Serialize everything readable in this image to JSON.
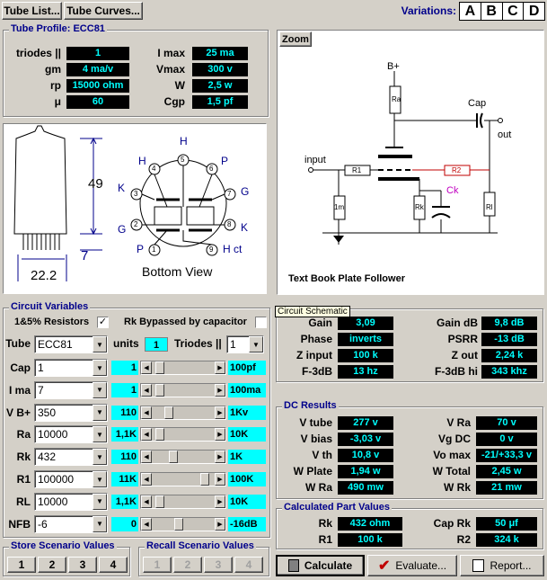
{
  "toolbar": {
    "tube_list": "Tube List...",
    "tube_curves": "Tube Curves...",
    "variations_label": "Variations:",
    "variations": [
      "A",
      "B",
      "C",
      "D"
    ]
  },
  "profile": {
    "title": "Tube Profile: ECC81",
    "left": [
      {
        "label": "triodes ||",
        "value": "1"
      },
      {
        "label": "gm",
        "value": "4 ma/v"
      },
      {
        "label": "rp",
        "value": "15000 ohm"
      },
      {
        "label": "μ",
        "value": "60"
      }
    ],
    "right": [
      {
        "label": "I max",
        "value": "25 ma"
      },
      {
        "label": "Vmax",
        "value": "300 v"
      },
      {
        "label": "W",
        "value": "2,5 w"
      },
      {
        "label": "Cgp",
        "value": "1,5 pf"
      }
    ]
  },
  "tube_drawing": {
    "dim_height": "49",
    "dim_pin": "7",
    "dim_width": "22.2",
    "caption": "Bottom View",
    "pins": [
      "1",
      "2",
      "3",
      "4",
      "5",
      "6",
      "7",
      "8",
      "9"
    ],
    "pin_labels": {
      "H_top": "H",
      "H_left": "H",
      "P_right": "P",
      "K_left": "K",
      "G_right": "G",
      "G_left": "G",
      "K_right": "K",
      "P_bottom": "P",
      "Hct": "H ct"
    }
  },
  "schematic": {
    "zoom": "Zoom",
    "bplus": "B+",
    "ra": "Ra",
    "cap": "Cap",
    "out": "out",
    "input": "input",
    "r1": "R1",
    "r2": "R2",
    "ck": "Ck",
    "one_m": "1m",
    "rk": "Rk",
    "rl": "Rl",
    "caption": "Text Book Plate Follower",
    "tooltip": "Circuit Schematic"
  },
  "circuit": {
    "title": "Circuit Variables",
    "resistors_label": "1&5% Resistors",
    "resistors_checked": "✓",
    "rk_bypass_label": "Rk Bypassed by capacitor",
    "rk_bypass_checked": "",
    "tube_label": "Tube",
    "tube_value": "ECC81",
    "units_label": "units",
    "units_value": "1",
    "triodes_label": "Triodes ||",
    "triodes_value": "1",
    "rows": [
      {
        "label": "Cap",
        "value": "1",
        "num": "1",
        "unit": "100pf",
        "level": 0.05
      },
      {
        "label": "I ma",
        "value": "7",
        "num": "1",
        "unit": "100ma",
        "level": 0.05
      },
      {
        "label": "V B+",
        "value": "350",
        "num": "110",
        "unit": "1Kv",
        "level": 0.22
      },
      {
        "label": "Ra",
        "value": "10000",
        "num": "1,1K",
        "unit": "10K",
        "level": 0.05
      },
      {
        "label": "Rk",
        "value": "432",
        "num": "110",
        "unit": "1K",
        "level": 0.3
      },
      {
        "label": "R1",
        "value": "100000",
        "num": "11K",
        "unit": "100K",
        "level": 0.9
      },
      {
        "label": "RL",
        "value": "10000",
        "num": "1,1K",
        "unit": "10K",
        "level": 0.05
      },
      {
        "label": "NFB",
        "value": "-6",
        "num": "0",
        "unit": "-16dB",
        "level": 0.4
      }
    ]
  },
  "store": {
    "title": "Store Scenario Values",
    "buttons": [
      "1",
      "2",
      "3",
      "4"
    ]
  },
  "recall": {
    "title": "Recall Scenario Values",
    "buttons": [
      "1",
      "2",
      "3",
      "4"
    ]
  },
  "perf": {
    "left": [
      {
        "label": "Gain",
        "value": "3,09"
      },
      {
        "label": "Phase",
        "value": "inverts"
      },
      {
        "label": "Z input",
        "value": "100 k"
      },
      {
        "label": "F-3dB",
        "value": "13 hz"
      }
    ],
    "right": [
      {
        "label": "Gain dB",
        "value": "9,8 dB"
      },
      {
        "label": "PSRR",
        "value": "-13 dB"
      },
      {
        "label": "Z out",
        "value": "2,24 k"
      },
      {
        "label": "F-3dB hi",
        "value": "343 khz"
      }
    ]
  },
  "dc": {
    "title": "DC Results",
    "left": [
      {
        "label": "V tube",
        "value": "277 v"
      },
      {
        "label": "V bias",
        "value": "-3,03 v"
      },
      {
        "label": "V th",
        "value": "10,8 v"
      },
      {
        "label": "W Plate",
        "value": "1,94 w"
      },
      {
        "label": "W Ra",
        "value": "490 mw"
      }
    ],
    "right": [
      {
        "label": "V Ra",
        "value": "70 v"
      },
      {
        "label": "Vg DC",
        "value": "0 v"
      },
      {
        "label": "Vo max",
        "value": "-21/+33,3 v"
      },
      {
        "label": "W Total",
        "value": "2,45 w"
      },
      {
        "label": "W Rk",
        "value": "21 mw"
      }
    ]
  },
  "parts": {
    "title": "Calculated Part Values",
    "left": [
      {
        "label": "Rk",
        "value": "432 ohm"
      },
      {
        "label": "R1",
        "value": "100 k"
      }
    ],
    "right": [
      {
        "label": "Cap Rk",
        "value": "50 μf"
      },
      {
        "label": "R2",
        "value": "324 k"
      }
    ]
  },
  "actions": {
    "calculate": "Calculate",
    "evaluate": "Evaluate...",
    "report": "Report..."
  }
}
